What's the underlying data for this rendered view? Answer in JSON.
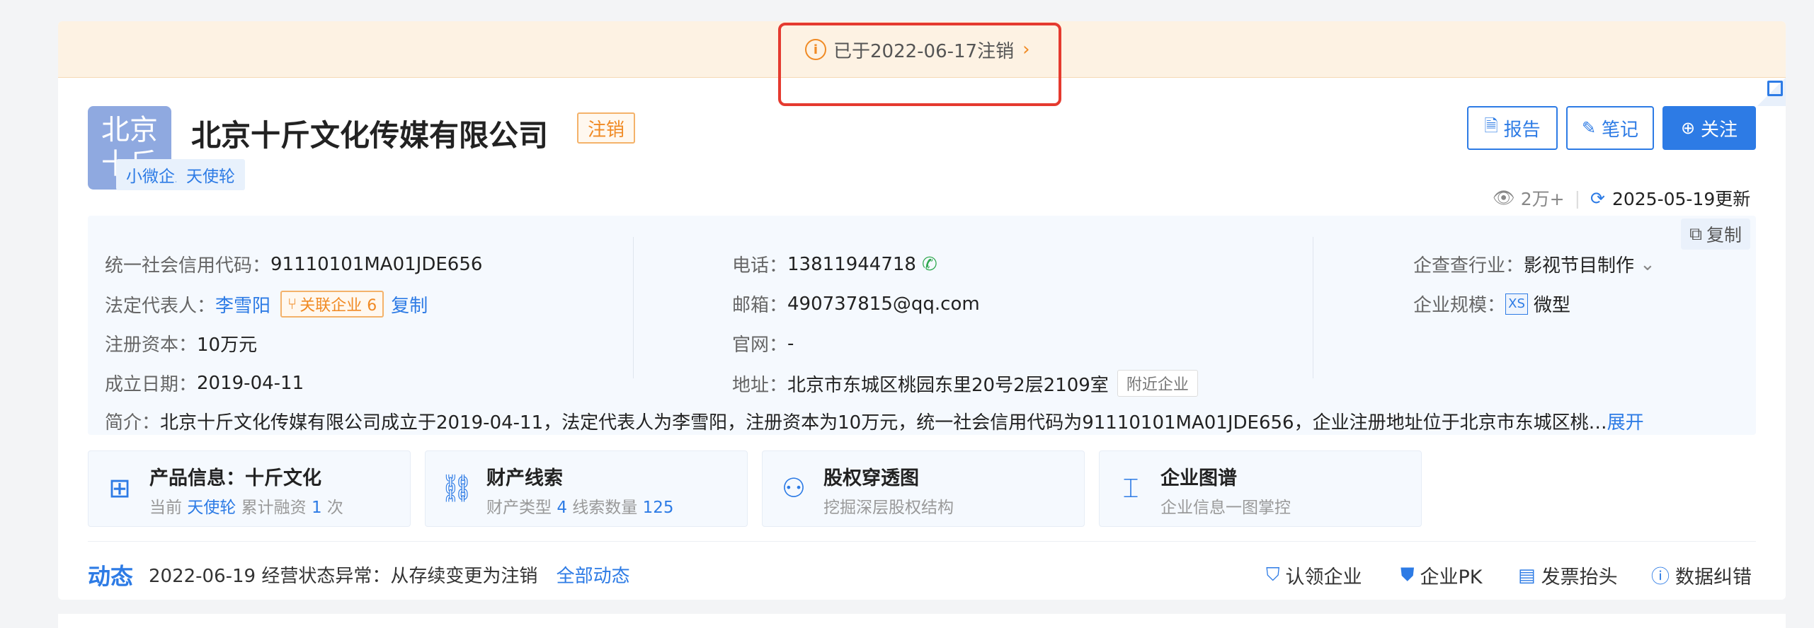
{
  "notice": {
    "text": "已于2022-06-17注销",
    "icon": "info-circle-icon",
    "arrow": "chevron-right-icon"
  },
  "company": {
    "logo_lines": [
      "北京",
      "十斤"
    ],
    "name": "北京十斤文化传媒有限公司",
    "status": "注销",
    "tags": [
      "小微企业",
      "天使轮"
    ]
  },
  "actions": {
    "report": "报告",
    "note": "笔记",
    "follow": "关注"
  },
  "meta": {
    "views": "2万+",
    "updated": "2025-05-19更新"
  },
  "info": {
    "copy": "复制",
    "credit_code_label": "统一社会信用代码：",
    "credit_code": "91110101MA01JDE656",
    "legal_label": "法定代表人：",
    "legal_rep": "李雪阳",
    "related_label": "关联企业 6",
    "legal_copy": "复制",
    "capital_label": "注册资本：",
    "capital": "10万元",
    "founded_label": "成立日期：",
    "founded": "2019-04-11",
    "phone_label": "电话：",
    "phone": "13811944718",
    "email_label": "邮箱：",
    "email": "490737815@qq.com",
    "website_label": "官网：",
    "website": "-",
    "address_label": "地址：",
    "address": "北京市东城区桃园东里20号2层2109室",
    "nearby": "附近企业",
    "industry_label": "企查查行业：",
    "industry": "影视节目制作",
    "scale_label": "企业规模：",
    "scale_badge": "XS",
    "scale": "微型",
    "intro_label": "简介：",
    "intro": "北京十斤文化传媒有限公司成立于2019-04-11，法定代表人为李雪阳，注册资本为10万元，统一社会信用代码为91110101MA01JDE656，企业注册地址位于北京市东城区桃…",
    "expand": "展开"
  },
  "features": [
    {
      "title": "产品信息：十斤文化",
      "sub_a": "当前 ",
      "sub_link": "天使轮",
      "sub_b": " 累计融资 ",
      "sub_num": "1",
      "sub_c": " 次"
    },
    {
      "title": "财产线索",
      "sub_a": "财产类型 ",
      "sub_num1": "4",
      "sub_b": " 线索数量 ",
      "sub_num2": "125"
    },
    {
      "title": "股权穿透图",
      "sub": "挖掘深层股权结构"
    },
    {
      "title": "企业图谱",
      "sub": "企业信息一图掌控"
    }
  ],
  "dynamics": {
    "title": "动态",
    "text": "2022-06-19 经营状态异常：从存续变更为注销",
    "all": "全部动态"
  },
  "bottom_actions": [
    "认领企业",
    "企业PK",
    "发票抬头",
    "数据纠错"
  ]
}
